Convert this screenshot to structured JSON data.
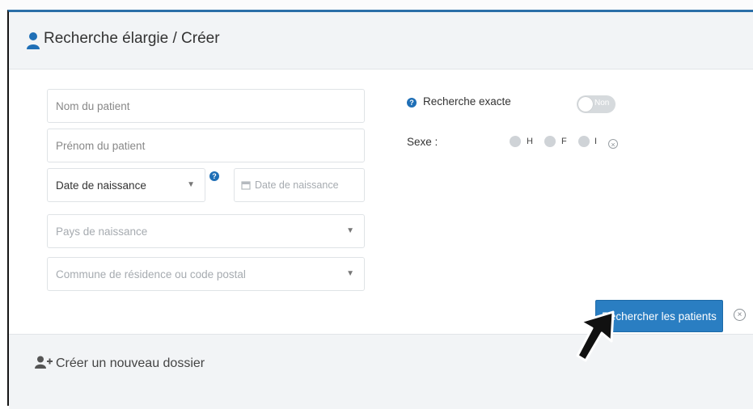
{
  "header": {
    "title": "Recherche élargie / Créer",
    "icon": "person-icon"
  },
  "form": {
    "nom_placeholder": "Nom du patient",
    "prenom_placeholder": "Prénom du patient",
    "date_type": "Date de naissance",
    "date_placeholder": "Date de naissance",
    "pays_placeholder": "Pays de naissance",
    "commune_placeholder": "Commune de résidence ou code postal"
  },
  "options": {
    "exact_label": "Recherche exacte",
    "toggle_text": "Non",
    "sexe_label": "Sexe :",
    "sexe_options": [
      "H",
      "F",
      "I"
    ]
  },
  "actions": {
    "search_label": "Rechercher les patients"
  },
  "footer": {
    "create_label": "Créer un nouveau dossier"
  },
  "colors": {
    "accent": "#2a7ec2",
    "header_bg": "#f2f4f6",
    "help_badge": "#1f6fb6"
  }
}
